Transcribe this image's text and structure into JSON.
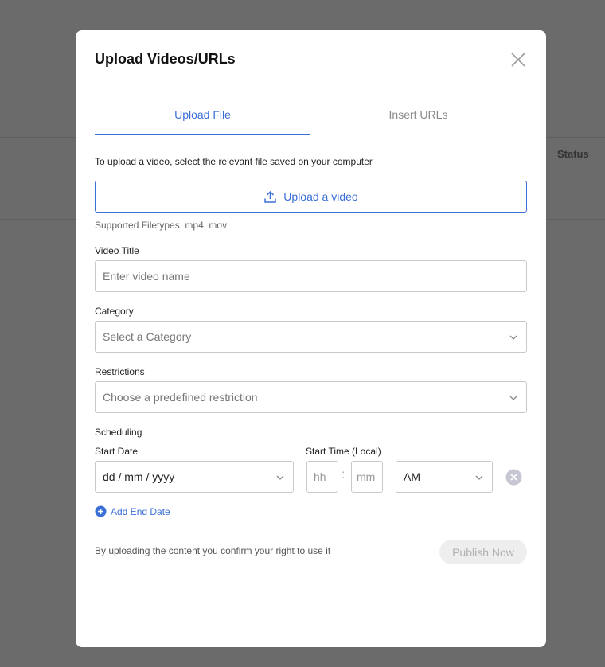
{
  "background": {
    "status_header": "Status"
  },
  "modal": {
    "title": "Upload Videos/URLs",
    "tabs": [
      {
        "label": "Upload File",
        "active": true
      },
      {
        "label": "Insert URLs",
        "active": false
      }
    ],
    "help_text": "To upload a video, select the relevant file saved on your computer",
    "upload_button_label": "Upload a video",
    "filetypes_text": "Supported Filetypes: mp4, mov",
    "video_title": {
      "label": "Video Title",
      "placeholder": "Enter video name"
    },
    "category": {
      "label": "Category",
      "placeholder": "Select a Category"
    },
    "restrictions": {
      "label": "Restrictions",
      "placeholder": "Choose a predefined restriction"
    },
    "scheduling": {
      "label": "Scheduling",
      "start_date_label": "Start Date",
      "start_date_placeholder": "dd / mm / yyyy",
      "start_time_label": "Start Time (Local)",
      "hour_placeholder": "hh",
      "minute_placeholder": "mm",
      "separator": ":",
      "meridiem_value": "AM"
    },
    "add_end_date_label": "Add End Date",
    "confirm_text": "By uploading the content you confirm your right to use it",
    "publish_label": "Publish Now"
  },
  "colors": {
    "accent": "#3b6fd8",
    "overlay": "#6b6b6b",
    "disabled_bg": "#eeeeee",
    "disabled_text": "#b0b0b0"
  },
  "icons": [
    "close-icon",
    "upload-icon",
    "chevron-down-icon",
    "clear-icon",
    "plus-circle-icon"
  ]
}
